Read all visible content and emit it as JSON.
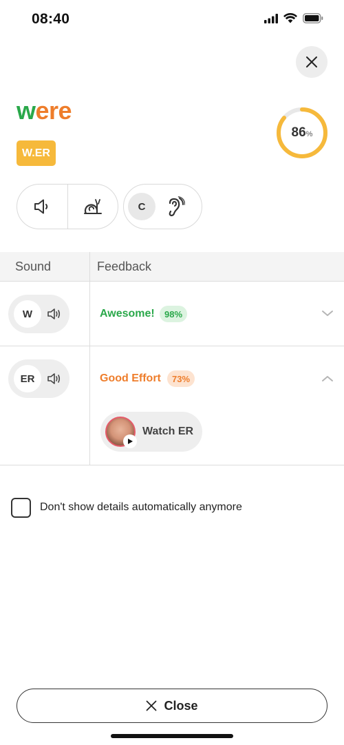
{
  "status_bar": {
    "time": "08:40"
  },
  "word": {
    "part1": "w",
    "part2": "ere"
  },
  "ipa_badge": "W.ER",
  "score": {
    "value": "86",
    "unit": "%",
    "fraction": 0.86
  },
  "controls": {
    "c_label": "C"
  },
  "table": {
    "sound_header": "Sound",
    "feedback_header": "Feedback",
    "rows": [
      {
        "sound": "W",
        "feedback": "Awesome!",
        "score": "98%",
        "level": "good"
      },
      {
        "sound": "ER",
        "feedback": "Good Effort",
        "score": "73%",
        "level": "effort"
      }
    ]
  },
  "watch": {
    "label": "Watch ER"
  },
  "checkbox": {
    "label": "Don't show details automatically anymore"
  },
  "close_button": {
    "label": "Close"
  },
  "colors": {
    "green": "#2aa84a",
    "orange": "#ee7d2b",
    "yellow": "#f6b93b"
  }
}
